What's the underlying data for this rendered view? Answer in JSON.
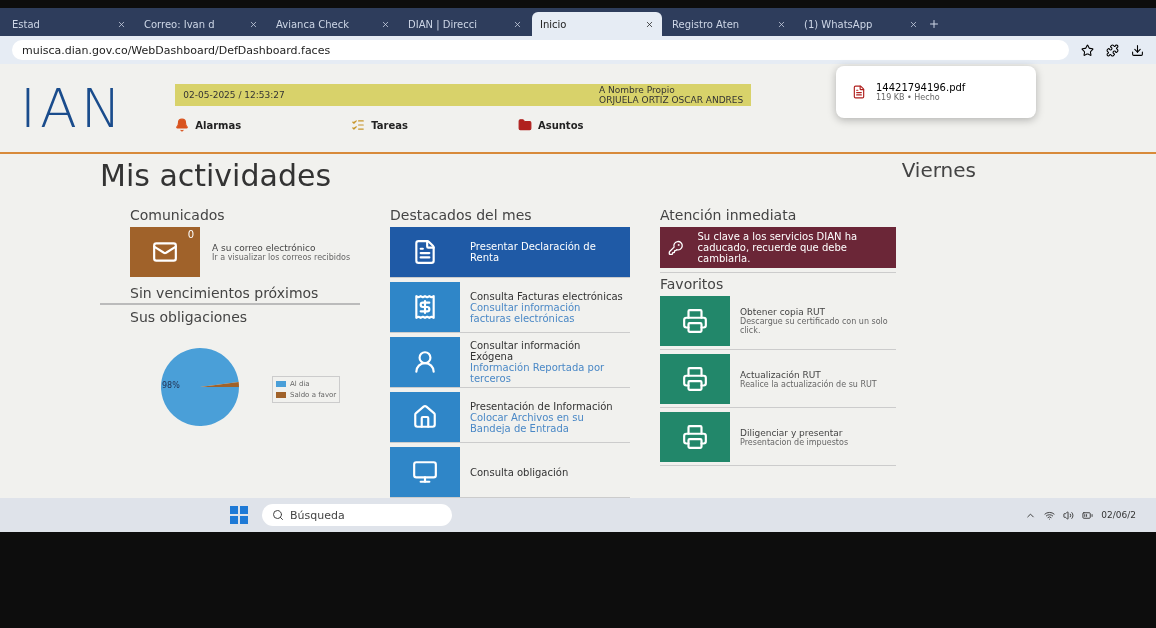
{
  "browser": {
    "tabs": [
      {
        "label": "Estad",
        "selected": false
      },
      {
        "label": "Correo: Ivan d",
        "selected": false
      },
      {
        "label": "Avianca Check",
        "selected": false
      },
      {
        "label": "DIAN | Direcci",
        "selected": false
      },
      {
        "label": "Inicio",
        "selected": true
      },
      {
        "label": "Registro Aten",
        "selected": false
      },
      {
        "label": "(1) WhatsApp",
        "selected": false
      }
    ],
    "url": "muisca.dian.gov.co/WebDashboard/DefDashboard.faces",
    "download": {
      "file": "14421794196.pdf",
      "info": "119 KB • Hecho"
    }
  },
  "header": {
    "logo": "IAN",
    "datetime": "02-05-2025 / 12:53:27",
    "role": "A Nombre Propio",
    "user": "ORJUELA ORTIZ OSCAR ANDRES",
    "nav": [
      {
        "label": "Alarmas",
        "kind": "bell"
      },
      {
        "label": "Tareas",
        "kind": "list"
      },
      {
        "label": "Asuntos",
        "kind": "folder"
      }
    ]
  },
  "page": {
    "title": "Mis actividades",
    "day": "Viernes"
  },
  "comunicados": {
    "title": "Comunicados",
    "count": "0",
    "heading": "A su correo electrónico",
    "text": "Ir a visualizar los correos recibidos"
  },
  "vencimientos": "Sin vencimientos próximos",
  "obligaciones": {
    "title": "Sus obligaciones",
    "chart_data": {
      "type": "pie",
      "categories": [
        "Al dia",
        "Saldo a favor"
      ],
      "values": [
        98,
        2
      ],
      "value_labels": [
        "98%",
        null
      ]
    }
  },
  "destacados": {
    "title": "Destacados del mes",
    "items": [
      {
        "kind": "form",
        "title": "Presentar Declaración de Renta",
        "selected": true
      },
      {
        "kind": "invoice",
        "title": "Consulta Facturas electrónicas",
        "text": "Consultar información facturas electrónicas",
        "selected": false
      },
      {
        "kind": "person",
        "title": "Consultar información Exógena",
        "text": "Información Reportada por terceros",
        "selected": false
      },
      {
        "kind": "house",
        "title": "Presentación de Información",
        "text": "Colocar Archivos en su Bandeja de Entrada",
        "selected": false
      },
      {
        "kind": "screen",
        "title": "Consulta obligación",
        "selected": false
      }
    ]
  },
  "atencion": {
    "title": "Atención inmediata",
    "text": "Su clave a los servicios DIAN ha caducado, recuerde que debe cambiarla."
  },
  "favoritos": {
    "title": "Favoritos",
    "items": [
      {
        "title": "Obtener copia RUT",
        "text": "Descargue su certificado con un solo click."
      },
      {
        "title": "Actualización RUT",
        "text": "Realice la actualización de su RUT"
      },
      {
        "title": "Diligenciar y presentar",
        "text": "Presentacion de impuestos"
      }
    ]
  },
  "taskbar": {
    "search": "Búsqueda",
    "date": "02/06/2"
  }
}
